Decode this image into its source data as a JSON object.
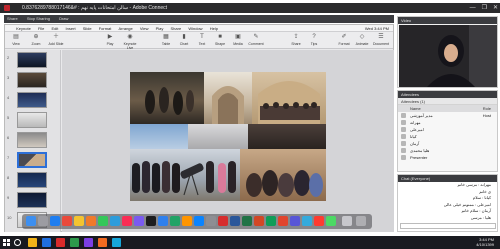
{
  "window": {
    "title": "0.8376289788017146&# : سالن امتحانات پایه نهم - Adobe Connect",
    "controls": [
      "—",
      "❐",
      "✕"
    ]
  },
  "share_bar": {
    "items": [
      "Share",
      "Stop Sharing",
      "Draw"
    ]
  },
  "keynote": {
    "menu": [
      "Keynote",
      "File",
      "Edit",
      "Insert",
      "Slide",
      "Format",
      "Arrange",
      "View",
      "Play",
      "Share",
      "Window",
      "Help"
    ],
    "menu_right": "Wed 3:44 PM",
    "toolbar": [
      {
        "label": "View",
        "icon": "▤"
      },
      {
        "label": "Zoom",
        "icon": "⊕"
      },
      {
        "label": "Add Slide",
        "icon": "＋"
      },
      {
        "label": "Play",
        "icon": "▶"
      },
      {
        "label": "Keynote Live",
        "icon": "◉"
      },
      {
        "label": "Table",
        "icon": "▦"
      },
      {
        "label": "Chart",
        "icon": "▮"
      },
      {
        "label": "Text",
        "icon": "T"
      },
      {
        "label": "Shape",
        "icon": "■"
      },
      {
        "label": "Media",
        "icon": "▣"
      },
      {
        "label": "Comment",
        "icon": "✎"
      },
      {
        "label": "Share",
        "icon": "⇪"
      },
      {
        "label": "Tips",
        "icon": "?"
      },
      {
        "label": "Format",
        "icon": "✐"
      },
      {
        "label": "Animate",
        "icon": "◇"
      },
      {
        "label": "Document",
        "icon": "☰"
      }
    ],
    "slides": [
      "2",
      "3",
      "4",
      "5",
      "6",
      "7",
      "8",
      "9",
      "10"
    ]
  },
  "video_pod": {
    "title": "Video"
  },
  "attendees": {
    "title": "Attendees",
    "subtitle": "Attendees (1)",
    "columns": [
      "Name",
      "Role"
    ],
    "rows": [
      {
        "name": "مدیر آموزشی",
        "role": "Host"
      },
      {
        "name": "مهرانه",
        "role": ""
      },
      {
        "name": "امیرعلی",
        "role": ""
      },
      {
        "name": "کیانا",
        "role": ""
      },
      {
        "name": "آرمان",
        "role": ""
      },
      {
        "name": "هلیا محمدی",
        "role": ""
      },
      {
        "name": "Presenter",
        "role": ""
      }
    ]
  },
  "chat": {
    "title": "Chat (Everyone)",
    "messages": [
      "مهرانه : مرسی خانم",
      "ی خانم",
      "کیانا : سلام",
      "امیرعلی : ممنونم خیلی عالی",
      "آرمان : سلام خانم",
      "هلیا : مرسی",
      "مدیر آموزشی : ممنون"
    ]
  },
  "taskbar": {
    "time": "3:44 PM",
    "date": "4/10/1399"
  },
  "colors": {
    "accent": "#2d6fd8",
    "titlebar": "#2a2a2c",
    "taskbar": "#191a20"
  }
}
